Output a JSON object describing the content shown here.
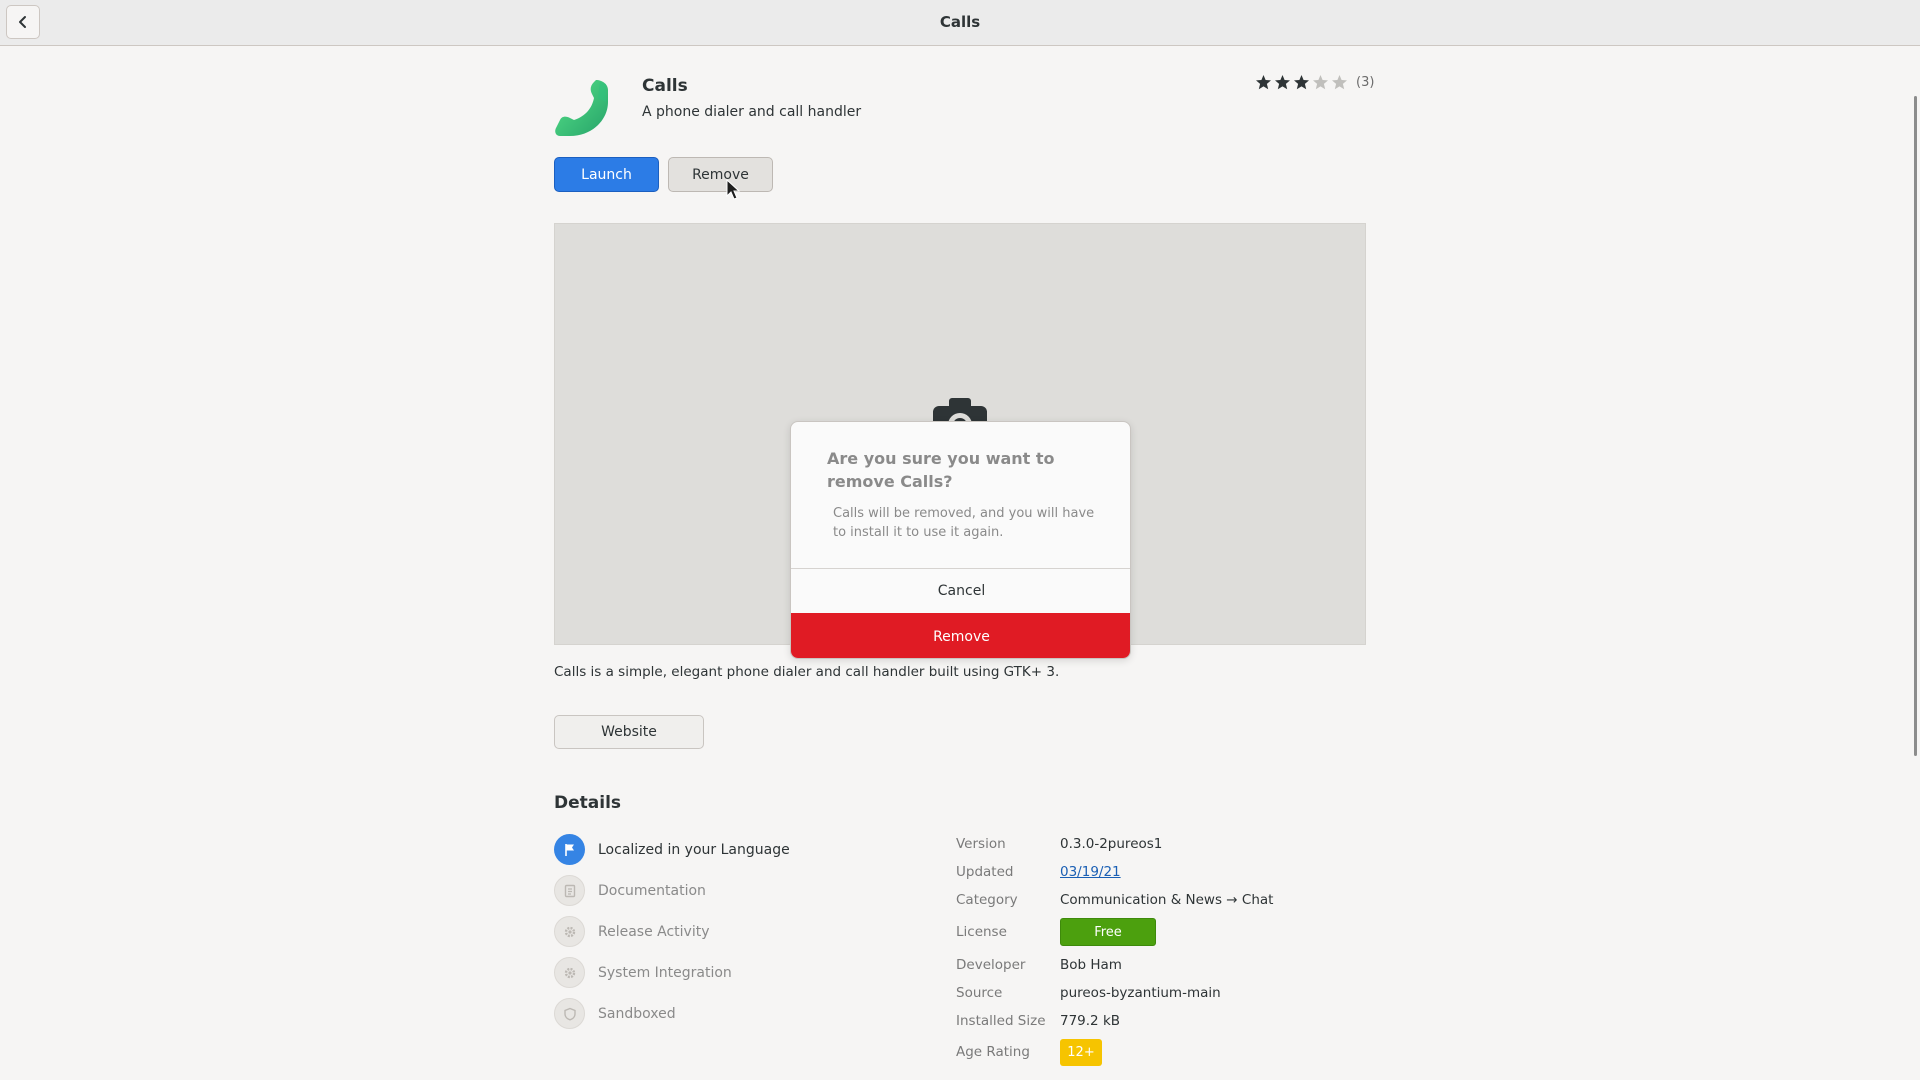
{
  "header": {
    "title": "Calls",
    "back_icon": "chevron-left-icon"
  },
  "app": {
    "name": "Calls",
    "summary": "A phone dialer and call handler",
    "icon": "phone-icon",
    "rating": {
      "stars": 3,
      "max": 5,
      "count": "(3)"
    },
    "launch_label": "Launch",
    "remove_label": "Remove",
    "description": "Calls is a simple, elegant phone dialer and call handler built using GTK+ 3.",
    "website_label": "Website"
  },
  "dialog": {
    "title": "Are you sure you want to remove Calls?",
    "body": "Calls will be removed, and you will have to install it to use it again.",
    "cancel_label": "Cancel",
    "remove_label": "Remove"
  },
  "details": {
    "heading": "Details",
    "features": [
      {
        "label": "Localized in your Language",
        "icon": "flag-icon",
        "active": true
      },
      {
        "label": "Documentation",
        "icon": "document-icon",
        "active": false
      },
      {
        "label": "Release Activity",
        "icon": "gear-icon",
        "active": false
      },
      {
        "label": "System Integration",
        "icon": "gear-icon",
        "active": false
      },
      {
        "label": "Sandboxed",
        "icon": "shield-icon",
        "active": false
      }
    ],
    "rows": [
      {
        "label": "Version",
        "value": "0.3.0-2pureos1"
      },
      {
        "label": "Updated",
        "value": "03/19/21"
      },
      {
        "label": "Category",
        "value": "Communication & News → Chat"
      },
      {
        "label": "License",
        "value": "Free"
      },
      {
        "label": "Developer",
        "value": "Bob Ham"
      },
      {
        "label": "Source",
        "value": "pureos-byzantium-main"
      },
      {
        "label": "Installed Size",
        "value": "779.2 kB"
      },
      {
        "label": "Age Rating",
        "value": "12+"
      }
    ]
  },
  "colors": {
    "accent": "#2c7ce6",
    "destructive": "#e01b24",
    "license_badge": "#4ca00e",
    "age_badge": "#f6c400"
  }
}
